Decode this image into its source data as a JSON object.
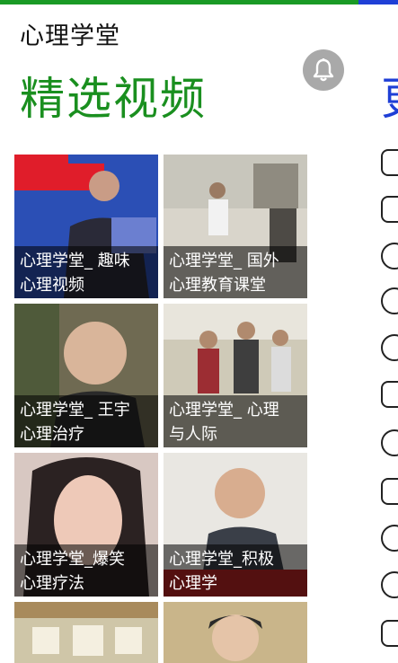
{
  "app": {
    "title": "心理学堂"
  },
  "section": {
    "title": "精选视频",
    "next_section_peek": "更"
  },
  "tiles": [
    {
      "caption": "心理学堂_ 趣味\n心理视频"
    },
    {
      "caption": "心理学堂_ 国外\n心理教育课堂"
    },
    {
      "caption": "心理学堂_ 王宇\n心理治疗"
    },
    {
      "caption": "心理学堂_ 心理\n与人际"
    },
    {
      "caption": "心理学堂_爆笑\n心理疗法"
    },
    {
      "caption": "心理学堂_积极\n心理学"
    },
    {
      "caption": ""
    },
    {
      "caption": ""
    }
  ],
  "colors": {
    "accent_green": "#1a8f1f",
    "accent_blue": "#1f3fd6",
    "bell_bg": "#a9a9a9"
  }
}
